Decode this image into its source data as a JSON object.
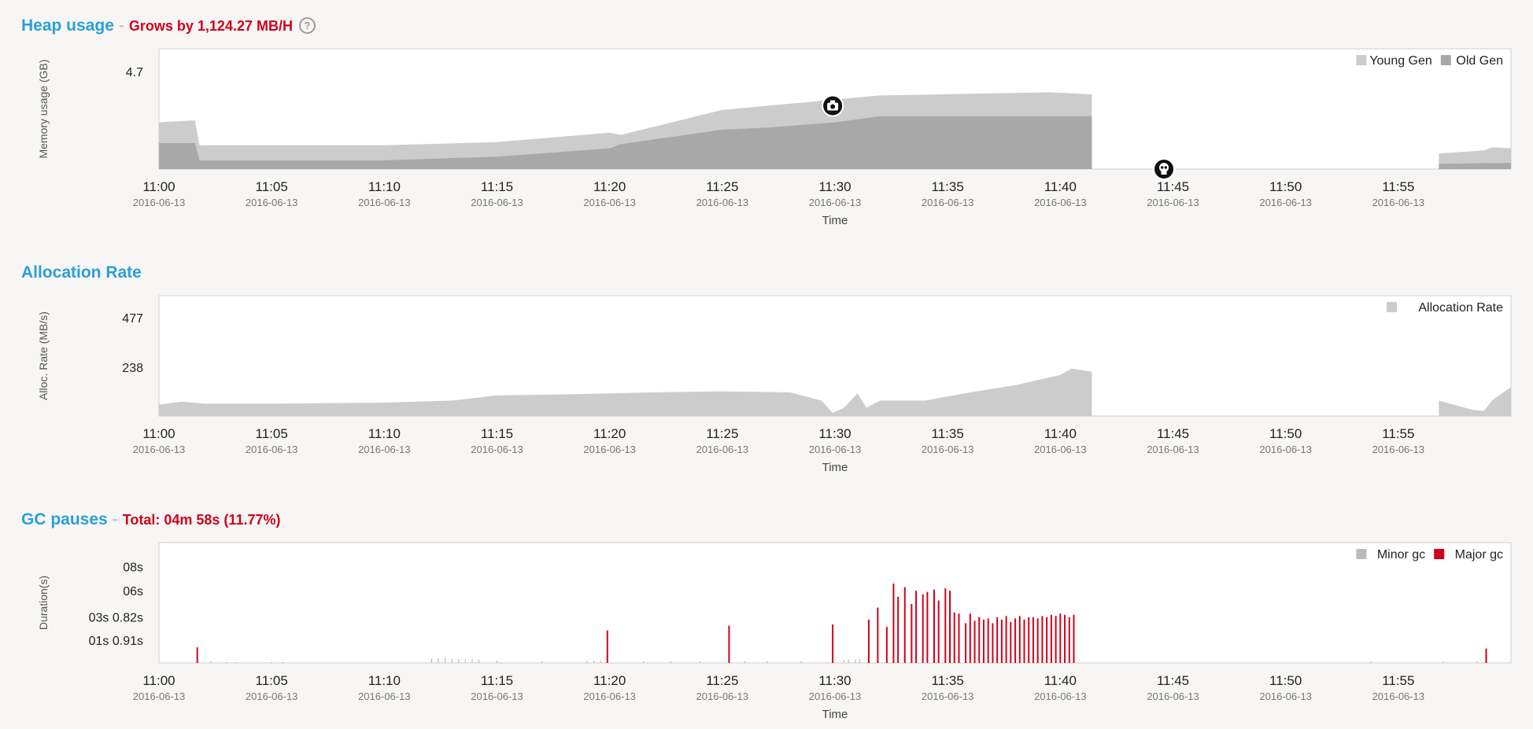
{
  "colors": {
    "title": "#2a9fd8",
    "alert": "#d0021b",
    "young": "#cccccc",
    "old": "#a8a8a8",
    "alloc": "#cccccc",
    "minor": "#bbbbbb",
    "major": "#d0021b",
    "background": "#f7f6f4"
  },
  "heap": {
    "title": "Heap usage",
    "subtitle": "Grows by 1,124.27 MB/H",
    "help_icon": "question-circle-icon"
  },
  "alloc": {
    "title": "Allocation Rate"
  },
  "gc": {
    "title": "GC pauses",
    "subtitle": "Total: 04m 58s (11.77%)"
  },
  "chart_data": [
    {
      "type": "area",
      "stacked": true,
      "ylabel": "Memory usage (GB)",
      "xlabel": "Time",
      "y_ticks": [
        "4.7"
      ],
      "ylim": [
        0,
        5.8
      ],
      "xlim": [
        0,
        60
      ],
      "x_ticks": [
        {
          "time": "11:00",
          "date": "2016-06-13"
        },
        {
          "time": "11:05",
          "date": "2016-06-13"
        },
        {
          "time": "11:10",
          "date": "2016-06-13"
        },
        {
          "time": "11:15",
          "date": "2016-06-13"
        },
        {
          "time": "11:20",
          "date": "2016-06-13"
        },
        {
          "time": "11:25",
          "date": "2016-06-13"
        },
        {
          "time": "11:30",
          "date": "2016-06-13"
        },
        {
          "time": "11:35",
          "date": "2016-06-13"
        },
        {
          "time": "11:40",
          "date": "2016-06-13"
        },
        {
          "time": "11:45",
          "date": "2016-06-13"
        },
        {
          "time": "11:50",
          "date": "2016-06-13"
        },
        {
          "time": "11:55",
          "date": "2016-06-13"
        }
      ],
      "legend": [
        "Young Gen",
        "Old Gen"
      ],
      "legend_position": "top-right",
      "series": [
        {
          "name": "Old Gen",
          "segments": [
            [
              [
                0,
                1.25
              ],
              [
                1.6,
                1.25
              ],
              [
                1.8,
                0.42
              ],
              [
                10,
                0.42
              ],
              [
                15,
                0.6
              ],
              [
                20,
                1.0
              ],
              [
                20.5,
                1.2
              ],
              [
                25,
                1.9
              ],
              [
                27,
                2.0
              ],
              [
                30,
                2.25
              ],
              [
                32,
                2.55
              ],
              [
                39.5,
                2.55
              ],
              [
                41.4,
                2.55
              ]
            ],
            [
              [
                56.8,
                0.25
              ],
              [
                60,
                0.3
              ]
            ]
          ]
        },
        {
          "name": "Young Gen",
          "segments": [
            [
              [
                0,
                2.25
              ],
              [
                1.6,
                2.35
              ],
              [
                1.8,
                1.15
              ],
              [
                10,
                1.15
              ],
              [
                15,
                1.3
              ],
              [
                20,
                1.75
              ],
              [
                20.5,
                1.65
              ],
              [
                25,
                2.85
              ],
              [
                30,
                3.35
              ],
              [
                32,
                3.55
              ],
              [
                39.5,
                3.7
              ],
              [
                41.4,
                3.6
              ]
            ],
            [
              [
                56.8,
                0.75
              ],
              [
                58.8,
                0.9
              ],
              [
                59.2,
                1.05
              ],
              [
                60,
                1.0
              ]
            ]
          ]
        }
      ],
      "markers": [
        {
          "time": 29.9,
          "value": 3.05,
          "icon": "camera-icon"
        },
        {
          "time": 44.6,
          "value": 0.0,
          "icon": "skull-icon"
        }
      ]
    },
    {
      "type": "area",
      "ylabel": "Alloc. Rate (MB/s)",
      "xlabel": "Time",
      "y_ticks": [
        "477",
        "238"
      ],
      "y_tick_values": [
        477,
        238
      ],
      "ylim": [
        0,
        585
      ],
      "xlim": [
        0,
        60
      ],
      "x_ticks": [
        {
          "time": "11:00",
          "date": "2016-06-13"
        },
        {
          "time": "11:05",
          "date": "2016-06-13"
        },
        {
          "time": "11:10",
          "date": "2016-06-13"
        },
        {
          "time": "11:15",
          "date": "2016-06-13"
        },
        {
          "time": "11:20",
          "date": "2016-06-13"
        },
        {
          "time": "11:25",
          "date": "2016-06-13"
        },
        {
          "time": "11:30",
          "date": "2016-06-13"
        },
        {
          "time": "11:35",
          "date": "2016-06-13"
        },
        {
          "time": "11:40",
          "date": "2016-06-13"
        },
        {
          "time": "11:45",
          "date": "2016-06-13"
        },
        {
          "time": "11:50",
          "date": "2016-06-13"
        },
        {
          "time": "11:55",
          "date": "2016-06-13"
        }
      ],
      "legend": [
        "Allocation Rate"
      ],
      "legend_position": "top-right",
      "series": [
        {
          "name": "Allocation Rate",
          "segments": [
            [
              [
                0,
                55
              ],
              [
                1,
                70
              ],
              [
                2,
                60
              ],
              [
                5,
                60
              ],
              [
                10,
                65
              ],
              [
                13,
                75
              ],
              [
                15,
                100
              ],
              [
                18,
                105
              ],
              [
                20,
                110
              ],
              [
                22,
                115
              ],
              [
                25,
                120
              ],
              [
                28,
                115
              ],
              [
                29.4,
                75
              ],
              [
                29.9,
                15
              ],
              [
                30.4,
                40
              ],
              [
                31,
                110
              ],
              [
                31.4,
                40
              ],
              [
                32,
                75
              ],
              [
                34,
                75
              ],
              [
                36,
                115
              ],
              [
                38,
                150
              ],
              [
                40,
                200
              ],
              [
                40.5,
                230
              ],
              [
                41.4,
                215
              ]
            ],
            [
              [
                56.8,
                75
              ],
              [
                58.3,
                30
              ],
              [
                58.8,
                25
              ],
              [
                59.2,
                80
              ],
              [
                60,
                140
              ]
            ]
          ]
        }
      ]
    },
    {
      "type": "bar",
      "ylabel": "Duration(s)",
      "xlabel": "Time",
      "y_ticks": [
        "08s",
        "06s",
        "03s 0.82s",
        "01s 0.91s"
      ],
      "y_tick_values": [
        8,
        6,
        3.82,
        1.91
      ],
      "ylim": [
        0,
        10
      ],
      "xlim": [
        0,
        60
      ],
      "x_ticks": [
        {
          "time": "11:00",
          "date": "2016-06-13"
        },
        {
          "time": "11:05",
          "date": "2016-06-13"
        },
        {
          "time": "11:10",
          "date": "2016-06-13"
        },
        {
          "time": "11:15",
          "date": "2016-06-13"
        },
        {
          "time": "11:20",
          "date": "2016-06-13"
        },
        {
          "time": "11:25",
          "date": "2016-06-13"
        },
        {
          "time": "11:30",
          "date": "2016-06-13"
        },
        {
          "time": "11:35",
          "date": "2016-06-13"
        },
        {
          "time": "11:40",
          "date": "2016-06-13"
        },
        {
          "time": "11:45",
          "date": "2016-06-13"
        },
        {
          "time": "11:50",
          "date": "2016-06-13"
        },
        {
          "time": "11:55",
          "date": "2016-06-13"
        }
      ],
      "legend": [
        "Minor gc",
        "Major gc"
      ],
      "legend_position": "top-right",
      "series": [
        {
          "name": "Minor gc",
          "x": [
            2.3,
            3.0,
            3.4,
            5.0,
            5.5,
            12.1,
            12.4,
            12.7,
            13.0,
            13.3,
            13.6,
            13.9,
            14.2,
            15.0,
            17.0,
            19.0,
            19.3,
            19.6,
            21.5,
            22.7,
            24.0,
            25.3,
            26.0,
            27.0,
            28.5,
            30.4,
            30.6,
            30.9,
            31.1,
            53.8,
            57.0,
            58.5
          ],
          "values": [
            0.15,
            0.1,
            0.1,
            0.1,
            0.1,
            0.35,
            0.4,
            0.45,
            0.35,
            0.3,
            0.3,
            0.3,
            0.25,
            0.2,
            0.15,
            0.2,
            0.2,
            0.2,
            0.15,
            0.15,
            0.15,
            0.15,
            0.15,
            0.15,
            0.15,
            0.25,
            0.3,
            0.3,
            0.3,
            0.15,
            0.15,
            0.15
          ]
        },
        {
          "name": "Major gc",
          "x": [
            1.7,
            19.9,
            25.3,
            29.9,
            31.5,
            31.9,
            32.3,
            32.6,
            32.8,
            33.1,
            33.4,
            33.6,
            33.9,
            34.1,
            34.4,
            34.6,
            34.9,
            35.1,
            35.3,
            35.5,
            35.8,
            36.0,
            36.2,
            36.4,
            36.6,
            36.8,
            37.0,
            37.2,
            37.4,
            37.6,
            37.8,
            38.0,
            38.2,
            38.4,
            38.6,
            38.8,
            39.0,
            39.2,
            39.4,
            39.6,
            39.8,
            40.0,
            40.2,
            40.4,
            40.6,
            58.9
          ],
          "values": [
            1.3,
            2.7,
            3.1,
            3.2,
            3.6,
            4.6,
            3.0,
            6.6,
            5.5,
            6.3,
            4.9,
            6.0,
            5.7,
            5.9,
            6.1,
            5.2,
            6.2,
            6.0,
            4.2,
            4.1,
            3.3,
            4.1,
            3.5,
            3.8,
            3.6,
            3.7,
            3.3,
            3.8,
            3.6,
            3.9,
            3.4,
            3.7,
            3.9,
            3.6,
            3.8,
            3.8,
            3.7,
            3.9,
            3.8,
            4.0,
            3.9,
            4.1,
            4.0,
            3.8,
            4.0,
            1.2
          ]
        }
      ]
    }
  ]
}
